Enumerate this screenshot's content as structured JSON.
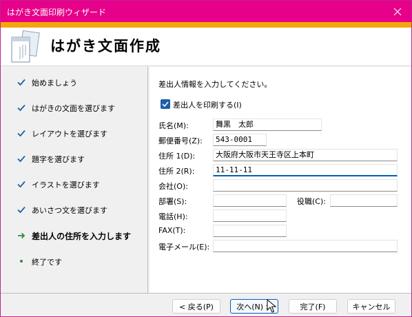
{
  "window": {
    "title": "はがき文面印刷ウィザード"
  },
  "header": {
    "heading": "はがき文面作成"
  },
  "steps": [
    {
      "label": "始めましょう",
      "state": "done"
    },
    {
      "label": "はがきの文面を選びます",
      "state": "done"
    },
    {
      "label": "レイアウトを選びます",
      "state": "done"
    },
    {
      "label": "題字を選びます",
      "state": "done"
    },
    {
      "label": "イラストを選びます",
      "state": "done"
    },
    {
      "label": "あいさつ文を選びます",
      "state": "done"
    },
    {
      "label": "差出人の住所を入力します",
      "state": "current"
    },
    {
      "label": "終了です",
      "state": "pending"
    }
  ],
  "form": {
    "instruction": "差出人情報を入力してください。",
    "print_sender_label": "差出人を印刷する(I)",
    "print_sender_checked": true,
    "name_label": "氏名(M):",
    "name_value": "舞黒　太郎",
    "postal_label": "郵便番号(Z):",
    "postal_value": "543-0001",
    "address1_label": "住所 1(D):",
    "address1_value": "大阪府大阪市天王寺区上本町",
    "address2_label": "住所 2(R):",
    "address2_value": "11-11-11",
    "company_label": "会社(O):",
    "company_value": "",
    "dept_label": "部署(S):",
    "dept_value": "",
    "title_label": "役職(C):",
    "title_value": "",
    "phone_label": "電話(H):",
    "phone_value": "",
    "fax_label": "FAX(T):",
    "fax_value": "",
    "email_label": "電子メール(E):",
    "email_value": ""
  },
  "footer": {
    "back_label": "< 戻る(P)",
    "next_label": "次へ(N) >",
    "finish_label": "完了(F)",
    "cancel_label": "キャンセル"
  },
  "colors": {
    "titlebar": "#e6008a",
    "accent_bar": "#f4a40c",
    "check_done": "#1f5fa8",
    "arrow_current": "#2e8b3a",
    "dot_pending": "#2e8b3a"
  },
  "icons": {
    "close": "close-icon",
    "done": "checkmark-icon",
    "current": "arrow-right-icon",
    "pending": "bullet-dot-icon",
    "logo": "document-stack-icon"
  }
}
